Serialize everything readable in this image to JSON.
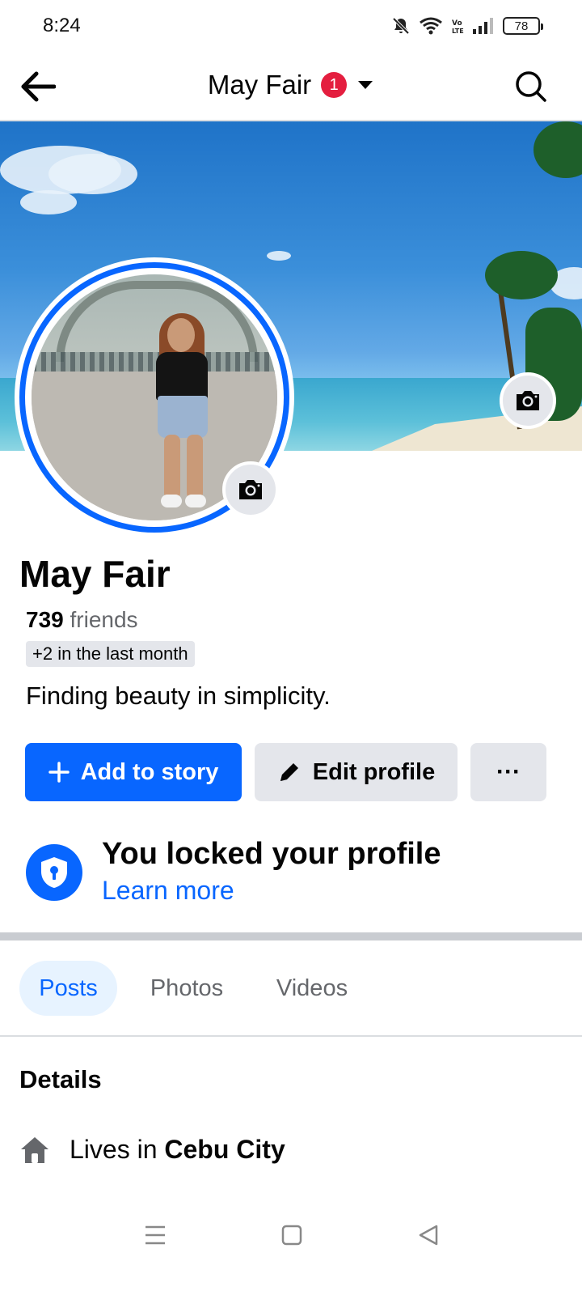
{
  "status_bar": {
    "time": "8:24",
    "battery": "78",
    "icons": [
      "bell-off-icon",
      "wifi-icon",
      "volte-icon",
      "signal-icon",
      "battery-icon"
    ]
  },
  "header": {
    "title": "May Fair",
    "notification_count": "1",
    "icons": [
      "back-arrow-icon",
      "caret-down-icon",
      "search-icon"
    ]
  },
  "profile": {
    "name": "May Fair",
    "friends_count": "739",
    "friends_label": " friends",
    "friends_delta": "+2 in the last month",
    "bio": "Finding beauty in simplicity."
  },
  "actions": {
    "add_story": "Add to story",
    "edit_profile": "Edit profile",
    "more": "···"
  },
  "locked": {
    "title": "You locked your profile",
    "link": "Learn more"
  },
  "tabs": [
    {
      "label": "Posts",
      "active": true
    },
    {
      "label": "Photos",
      "active": false
    },
    {
      "label": "Videos",
      "active": false
    }
  ],
  "details": {
    "title": "Details",
    "lives_prefix": "Lives in ",
    "lives_city": "Cebu City"
  },
  "colors": {
    "accent": "#0866ff",
    "badge": "#e41e3f",
    "button_gray": "#e4e6eb",
    "tab_active_bg": "#e7f3ff"
  }
}
